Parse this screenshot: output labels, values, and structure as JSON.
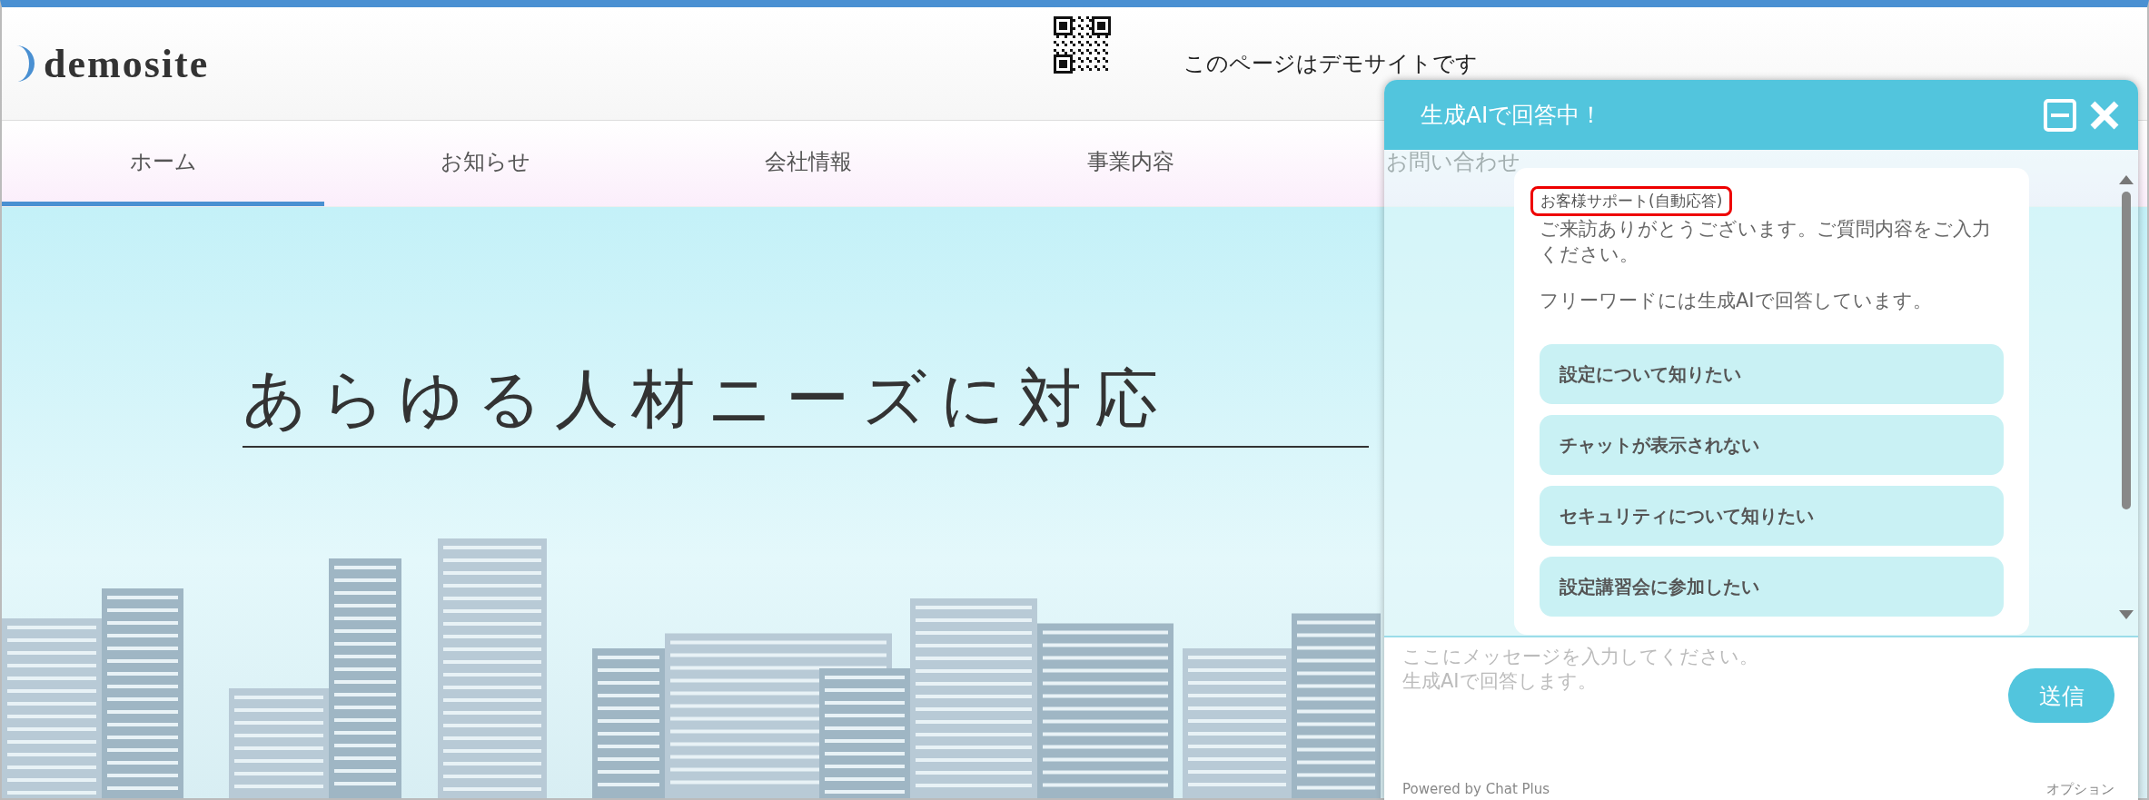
{
  "header": {
    "logo": "demosite",
    "notice": "このページはデモサイトです"
  },
  "nav": [
    {
      "label": "ホーム",
      "selected": true
    },
    {
      "label": "お知らせ",
      "selected": false
    },
    {
      "label": "会社情報",
      "selected": false
    },
    {
      "label": "事業内容",
      "selected": false
    },
    {
      "label": "お問い合わせ",
      "selected": false
    }
  ],
  "hero": {
    "headline": "あらゆる人材ニーズに対応"
  },
  "chat": {
    "title": "生成AIで回答中！",
    "sender": "お客様サポート(自動応答)",
    "sender_highlighted": true,
    "messages": [
      "ご来訪ありがとうございます。ご質問内容をご入力ください。",
      "フリーワードには生成AIで回答しています。"
    ],
    "options": [
      "設定について知りたい",
      "チャットが表示されない",
      "セキュリティについて知りたい",
      "設定講習会に参加したい"
    ],
    "input": {
      "placeholder": "ここにメッセージを入力してください。生成AIで回答します。"
    },
    "send": "送信",
    "powered_by": "Powered by Chat Plus",
    "options_link": "オプション"
  }
}
